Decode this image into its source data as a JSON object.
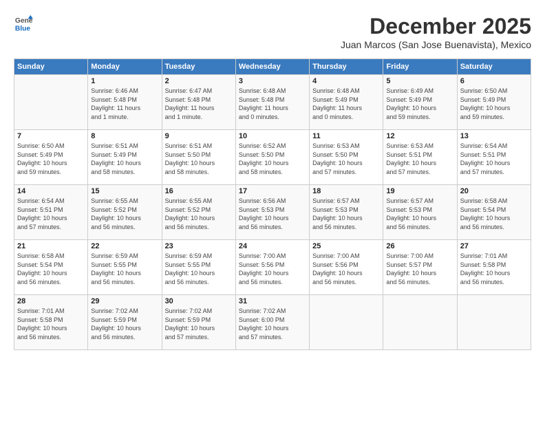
{
  "header": {
    "logo_general": "General",
    "logo_blue": "Blue",
    "month_title": "December 2025",
    "subtitle": "Juan Marcos (San Jose Buenavista), Mexico"
  },
  "columns": [
    "Sunday",
    "Monday",
    "Tuesday",
    "Wednesday",
    "Thursday",
    "Friday",
    "Saturday"
  ],
  "weeks": [
    [
      {
        "day": "",
        "info": ""
      },
      {
        "day": "1",
        "info": "Sunrise: 6:46 AM\nSunset: 5:48 PM\nDaylight: 11 hours\nand 1 minute."
      },
      {
        "day": "2",
        "info": "Sunrise: 6:47 AM\nSunset: 5:48 PM\nDaylight: 11 hours\nand 1 minute."
      },
      {
        "day": "3",
        "info": "Sunrise: 6:48 AM\nSunset: 5:48 PM\nDaylight: 11 hours\nand 0 minutes."
      },
      {
        "day": "4",
        "info": "Sunrise: 6:48 AM\nSunset: 5:49 PM\nDaylight: 11 hours\nand 0 minutes."
      },
      {
        "day": "5",
        "info": "Sunrise: 6:49 AM\nSunset: 5:49 PM\nDaylight: 10 hours\nand 59 minutes."
      },
      {
        "day": "6",
        "info": "Sunrise: 6:50 AM\nSunset: 5:49 PM\nDaylight: 10 hours\nand 59 minutes."
      }
    ],
    [
      {
        "day": "7",
        "info": "Sunrise: 6:50 AM\nSunset: 5:49 PM\nDaylight: 10 hours\nand 59 minutes."
      },
      {
        "day": "8",
        "info": "Sunrise: 6:51 AM\nSunset: 5:49 PM\nDaylight: 10 hours\nand 58 minutes."
      },
      {
        "day": "9",
        "info": "Sunrise: 6:51 AM\nSunset: 5:50 PM\nDaylight: 10 hours\nand 58 minutes."
      },
      {
        "day": "10",
        "info": "Sunrise: 6:52 AM\nSunset: 5:50 PM\nDaylight: 10 hours\nand 58 minutes."
      },
      {
        "day": "11",
        "info": "Sunrise: 6:53 AM\nSunset: 5:50 PM\nDaylight: 10 hours\nand 57 minutes."
      },
      {
        "day": "12",
        "info": "Sunrise: 6:53 AM\nSunset: 5:51 PM\nDaylight: 10 hours\nand 57 minutes."
      },
      {
        "day": "13",
        "info": "Sunrise: 6:54 AM\nSunset: 5:51 PM\nDaylight: 10 hours\nand 57 minutes."
      }
    ],
    [
      {
        "day": "14",
        "info": "Sunrise: 6:54 AM\nSunset: 5:51 PM\nDaylight: 10 hours\nand 57 minutes."
      },
      {
        "day": "15",
        "info": "Sunrise: 6:55 AM\nSunset: 5:52 PM\nDaylight: 10 hours\nand 56 minutes."
      },
      {
        "day": "16",
        "info": "Sunrise: 6:55 AM\nSunset: 5:52 PM\nDaylight: 10 hours\nand 56 minutes."
      },
      {
        "day": "17",
        "info": "Sunrise: 6:56 AM\nSunset: 5:53 PM\nDaylight: 10 hours\nand 56 minutes."
      },
      {
        "day": "18",
        "info": "Sunrise: 6:57 AM\nSunset: 5:53 PM\nDaylight: 10 hours\nand 56 minutes."
      },
      {
        "day": "19",
        "info": "Sunrise: 6:57 AM\nSunset: 5:53 PM\nDaylight: 10 hours\nand 56 minutes."
      },
      {
        "day": "20",
        "info": "Sunrise: 6:58 AM\nSunset: 5:54 PM\nDaylight: 10 hours\nand 56 minutes."
      }
    ],
    [
      {
        "day": "21",
        "info": "Sunrise: 6:58 AM\nSunset: 5:54 PM\nDaylight: 10 hours\nand 56 minutes."
      },
      {
        "day": "22",
        "info": "Sunrise: 6:59 AM\nSunset: 5:55 PM\nDaylight: 10 hours\nand 56 minutes."
      },
      {
        "day": "23",
        "info": "Sunrise: 6:59 AM\nSunset: 5:55 PM\nDaylight: 10 hours\nand 56 minutes."
      },
      {
        "day": "24",
        "info": "Sunrise: 7:00 AM\nSunset: 5:56 PM\nDaylight: 10 hours\nand 56 minutes."
      },
      {
        "day": "25",
        "info": "Sunrise: 7:00 AM\nSunset: 5:56 PM\nDaylight: 10 hours\nand 56 minutes."
      },
      {
        "day": "26",
        "info": "Sunrise: 7:00 AM\nSunset: 5:57 PM\nDaylight: 10 hours\nand 56 minutes."
      },
      {
        "day": "27",
        "info": "Sunrise: 7:01 AM\nSunset: 5:58 PM\nDaylight: 10 hours\nand 56 minutes."
      }
    ],
    [
      {
        "day": "28",
        "info": "Sunrise: 7:01 AM\nSunset: 5:58 PM\nDaylight: 10 hours\nand 56 minutes."
      },
      {
        "day": "29",
        "info": "Sunrise: 7:02 AM\nSunset: 5:59 PM\nDaylight: 10 hours\nand 56 minutes."
      },
      {
        "day": "30",
        "info": "Sunrise: 7:02 AM\nSunset: 5:59 PM\nDaylight: 10 hours\nand 57 minutes."
      },
      {
        "day": "31",
        "info": "Sunrise: 7:02 AM\nSunset: 6:00 PM\nDaylight: 10 hours\nand 57 minutes."
      },
      {
        "day": "",
        "info": ""
      },
      {
        "day": "",
        "info": ""
      },
      {
        "day": "",
        "info": ""
      }
    ]
  ]
}
